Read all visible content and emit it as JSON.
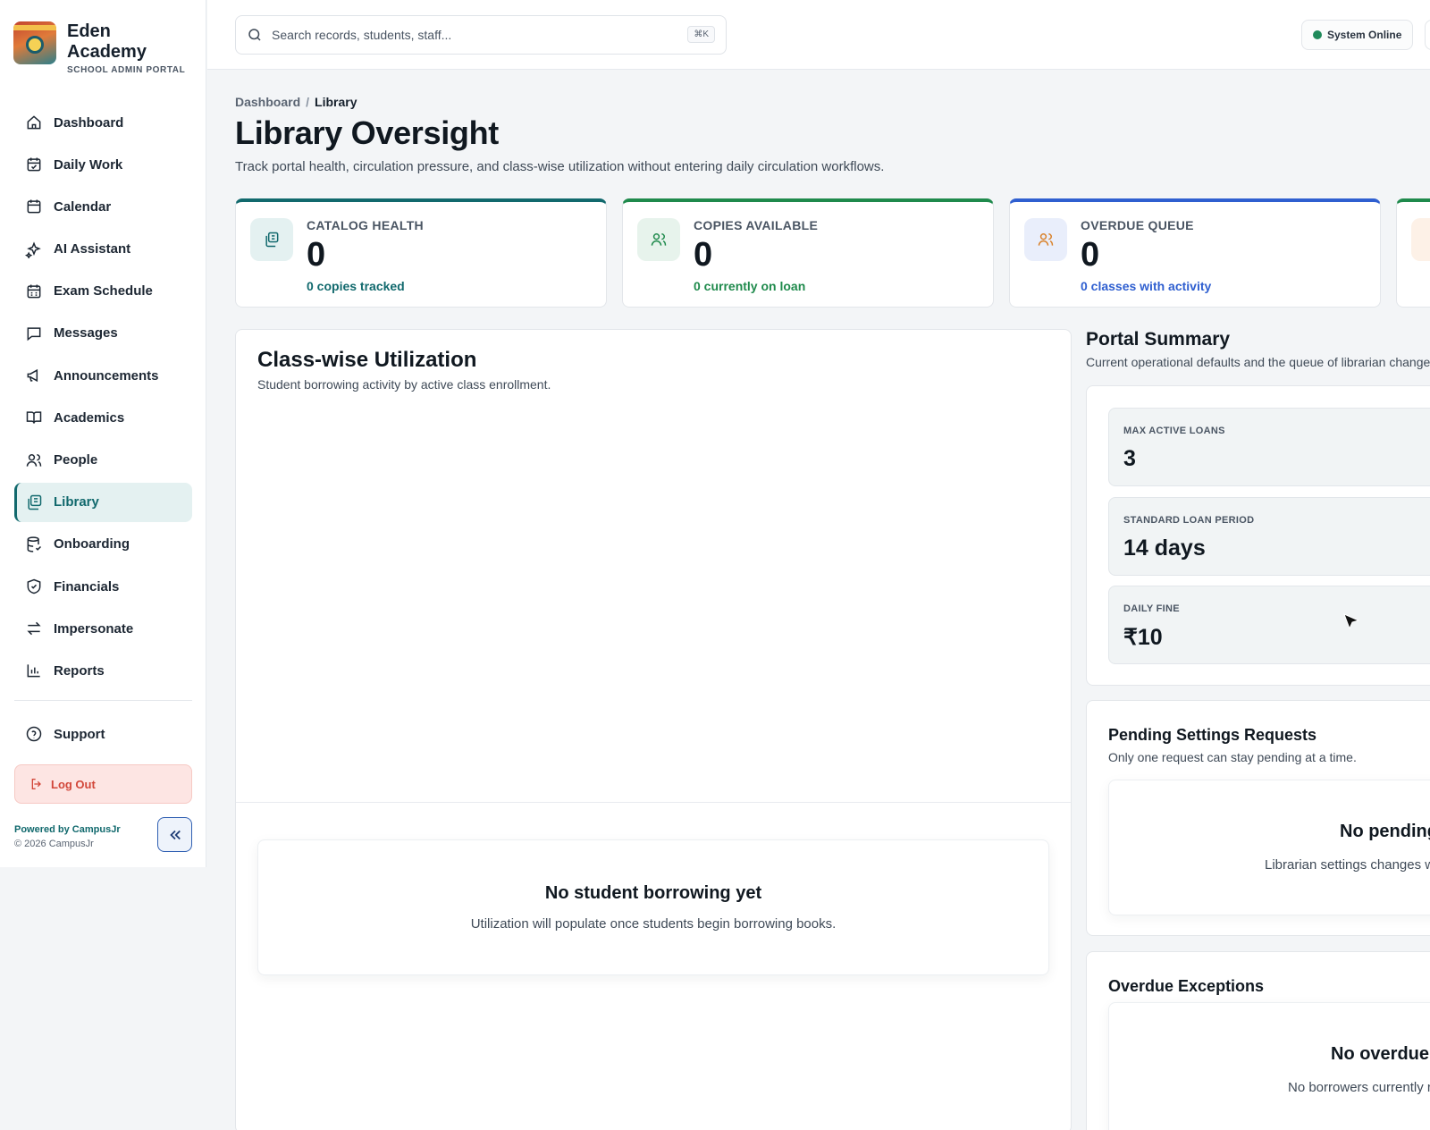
{
  "brand": {
    "name_line1": "Eden",
    "name_line2": "Academy",
    "subtitle": "SCHOOL ADMIN PORTAL"
  },
  "sidebar": {
    "items": [
      {
        "label": "Dashboard",
        "icon": "home-icon"
      },
      {
        "label": "Daily Work",
        "icon": "calendar-check-icon"
      },
      {
        "label": "Calendar",
        "icon": "calendar-icon"
      },
      {
        "label": "AI Assistant",
        "icon": "sparkles-icon"
      },
      {
        "label": "Exam Schedule",
        "icon": "calendar-grid-icon"
      },
      {
        "label": "Messages",
        "icon": "message-icon"
      },
      {
        "label": "Announcements",
        "icon": "megaphone-icon"
      },
      {
        "label": "Academics",
        "icon": "book-icon"
      },
      {
        "label": "People",
        "icon": "users-icon"
      },
      {
        "label": "Library",
        "icon": "library-icon",
        "active": true
      },
      {
        "label": "Onboarding",
        "icon": "database-icon"
      },
      {
        "label": "Financials",
        "icon": "shield-check-icon"
      },
      {
        "label": "Impersonate",
        "icon": "arrows-swap-icon"
      },
      {
        "label": "Reports",
        "icon": "bar-chart-icon"
      }
    ],
    "support_label": "Support",
    "logout_label": "Log Out",
    "powered_by": "Powered by CampusJr",
    "copyright": "© 2026 CampusJr"
  },
  "topbar": {
    "search_placeholder": "Search records, students, staff...",
    "search_shortcut": "⌘K",
    "status_label": "System Online"
  },
  "breadcrumb": {
    "root": "Dashboard",
    "separator": "/",
    "current": "Library"
  },
  "page": {
    "title": "Library Oversight",
    "subtitle": "Track portal health, circulation pressure, and class-wise utilization without entering daily circulation workflows."
  },
  "stats": [
    {
      "label": "CATALOG HEALTH",
      "value": "0",
      "sub": "0 copies tracked",
      "accent": "#11696d",
      "icon": "copies-icon"
    },
    {
      "label": "COPIES AVAILABLE",
      "value": "0",
      "sub": "0 currently on loan",
      "accent": "#1f8a4c",
      "icon": "users-icon"
    },
    {
      "label": "OVERDUE QUEUE",
      "value": "0",
      "sub": "0 classes with activity",
      "accent": "#2f5fd0",
      "icon": "users-icon"
    }
  ],
  "utilization": {
    "title": "Class-wise Utilization",
    "subtitle": "Student borrowing activity by active class enrollment.",
    "empty_title": "No student borrowing yet",
    "empty_text": "Utilization will populate once students begin borrowing books."
  },
  "summary": {
    "title": "Portal Summary",
    "subtitle": "Current operational defaults and the queue of librarian change",
    "items": [
      {
        "label": "MAX ACTIVE LOANS",
        "value": "3"
      },
      {
        "label": "STANDARD LOAN PERIOD",
        "value": "14 days"
      },
      {
        "label": "DAILY FINE",
        "value": "₹10"
      }
    ]
  },
  "pending": {
    "title": "Pending Settings Requests",
    "subtitle": "Only one request can stay pending at a time.",
    "empty_title": "No pending",
    "empty_text": "Librarian settings changes w"
  },
  "overdue": {
    "title": "Overdue Exceptions",
    "empty_title": "No overdue",
    "empty_text": "No borrowers currently r"
  }
}
